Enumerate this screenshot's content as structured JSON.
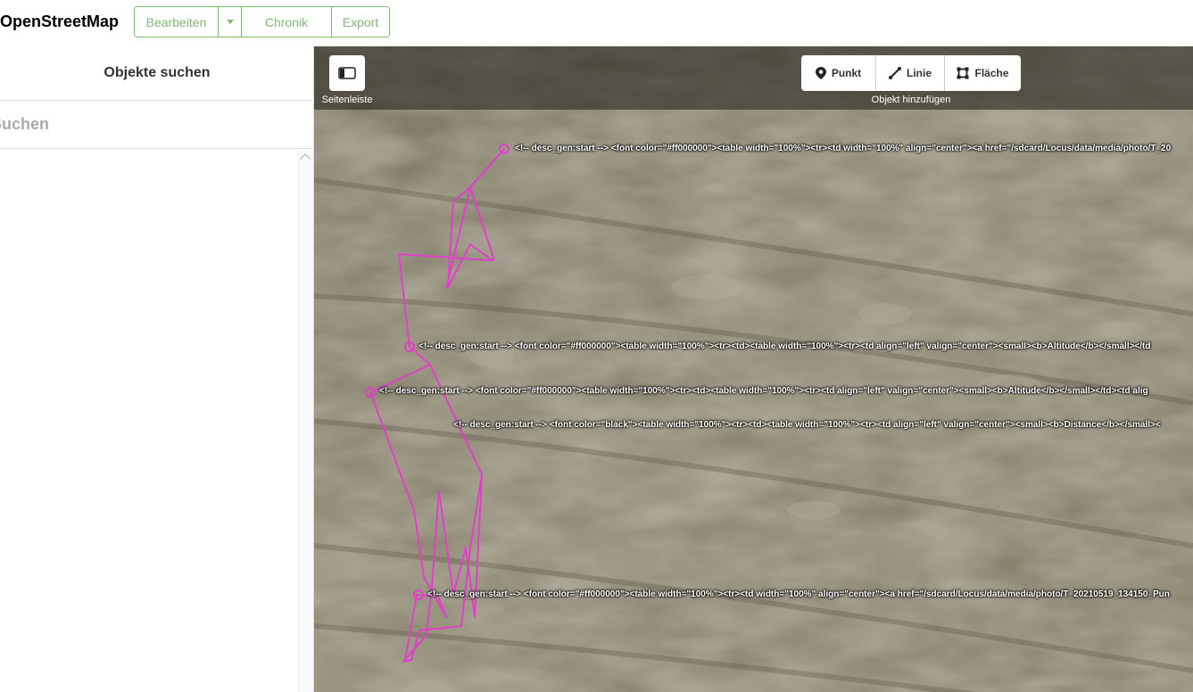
{
  "header": {
    "logo": "OpenStreetMap",
    "edit_label": "Bearbeiten",
    "history_label": "Chronik",
    "export_label": "Export",
    "accent_color": "#7ebc6f"
  },
  "sidebar": {
    "title": "Objekte suchen",
    "search_placeholder": "Suchen"
  },
  "map": {
    "sidebar_toggle_label": "Seitenleiste",
    "add_label": "Objekt hinzufügen",
    "modes": {
      "point": "Punkt",
      "line": "Linie",
      "area": "Fläche"
    },
    "track_color": "#e040c8",
    "labels": [
      "<!-- desc_gen:start --> <font color=\"#ff000000\"><table width=\"100%\"><tr><td width=\"100%\" align=\"center\"><a href=\"/sdcard/Locus/data/media/photo/T_20",
      "<!-- desc_gen:start --> <font color=\"#ff000000\"><table width=\"100%\"><tr><td><table width=\"100%\"><tr><td align=\"left\" valign=\"center\"><small><b>Altitude</b></small></td",
      "<!-- desc_gen:start --> <font color=\"#ff000000\"><table width=\"100%\"><tr><td><table width=\"100%\"><tr><td align=\"left\" valign=\"center\"><small><b>Altitude</b></small></td><td alig",
      "<!-- desc_gen:start --> <font color=\"black\"><table width=\"100%\"><tr><td><table width=\"100%\"><tr><td align=\"left\" valign=\"center\"><small><b>Distance</b></small><",
      "<!-- desc_gen:start --> <font color=\"#ff000000\"><table width=\"100%\"><tr><td width=\"100%\" align=\"center\"><a href=\"/sdcard/Locus/data/media/photo/T_20210519_134150_Pun"
    ]
  }
}
